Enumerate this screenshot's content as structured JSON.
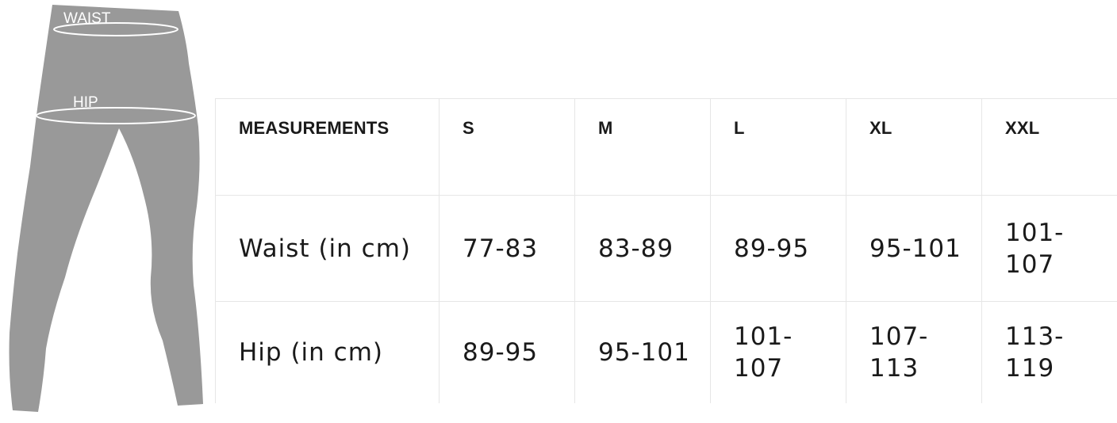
{
  "figure": {
    "labels": {
      "waist": "WAIST",
      "hip": "HIP"
    },
    "colors": {
      "garment": "#999999",
      "outline": "#ffffff"
    }
  },
  "table": {
    "header": {
      "label": "MEASUREMENTS",
      "sizes": [
        "S",
        "M",
        "L",
        "XL",
        "XXL"
      ]
    },
    "rows": [
      {
        "label": "Waist (in cm)",
        "values": [
          "77-83",
          "83-89",
          "89-95",
          "95-101",
          "101-\n107"
        ]
      },
      {
        "label": "Hip (in cm)",
        "values": [
          "89-95",
          "95-101",
          "101-\n107",
          "107-\n113",
          "113-\n119"
        ]
      }
    ],
    "colors": {
      "border": "#e6e6e6",
      "text": "#1a1a1a"
    }
  }
}
